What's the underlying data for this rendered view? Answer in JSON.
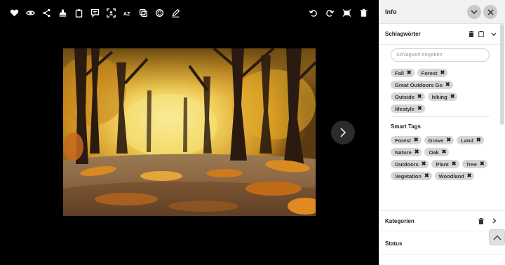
{
  "viewer": {
    "toolbar_left_icons": [
      "heart-icon",
      "eye-icon",
      "share-icon",
      "stamp-icon",
      "clipboard-icon",
      "comment-icon",
      "face-scan-icon",
      "az-text-icon",
      "copy-icon",
      "sync-icon",
      "pencil-icon"
    ],
    "toolbar_right_icons": [
      "undo-icon",
      "redo-icon",
      "crop-icon",
      "trash-icon"
    ]
  },
  "panel": {
    "title": "Info",
    "keywords": {
      "title": "Schlagwörter",
      "placeholder": "Schlagwort eingeben",
      "tags": [
        "Fall",
        "Forest",
        "Great Outdoors Go",
        "Outside",
        "hiking",
        "lifestyle"
      ]
    },
    "smart_tags": {
      "title": "Smart Tags",
      "tags": [
        "Forest",
        "Grove",
        "Land",
        "Nature",
        "Oak",
        "Outdoors",
        "Plant",
        "Tree",
        "Vegetation",
        "Woodland"
      ]
    },
    "categories": {
      "title": "Kategorien"
    },
    "status": {
      "title": "Status"
    }
  },
  "colors": {
    "tag_bg": "#d6d6d6",
    "panel_header": "#f2f2f2",
    "autumn_gold": "#e0a52a"
  }
}
